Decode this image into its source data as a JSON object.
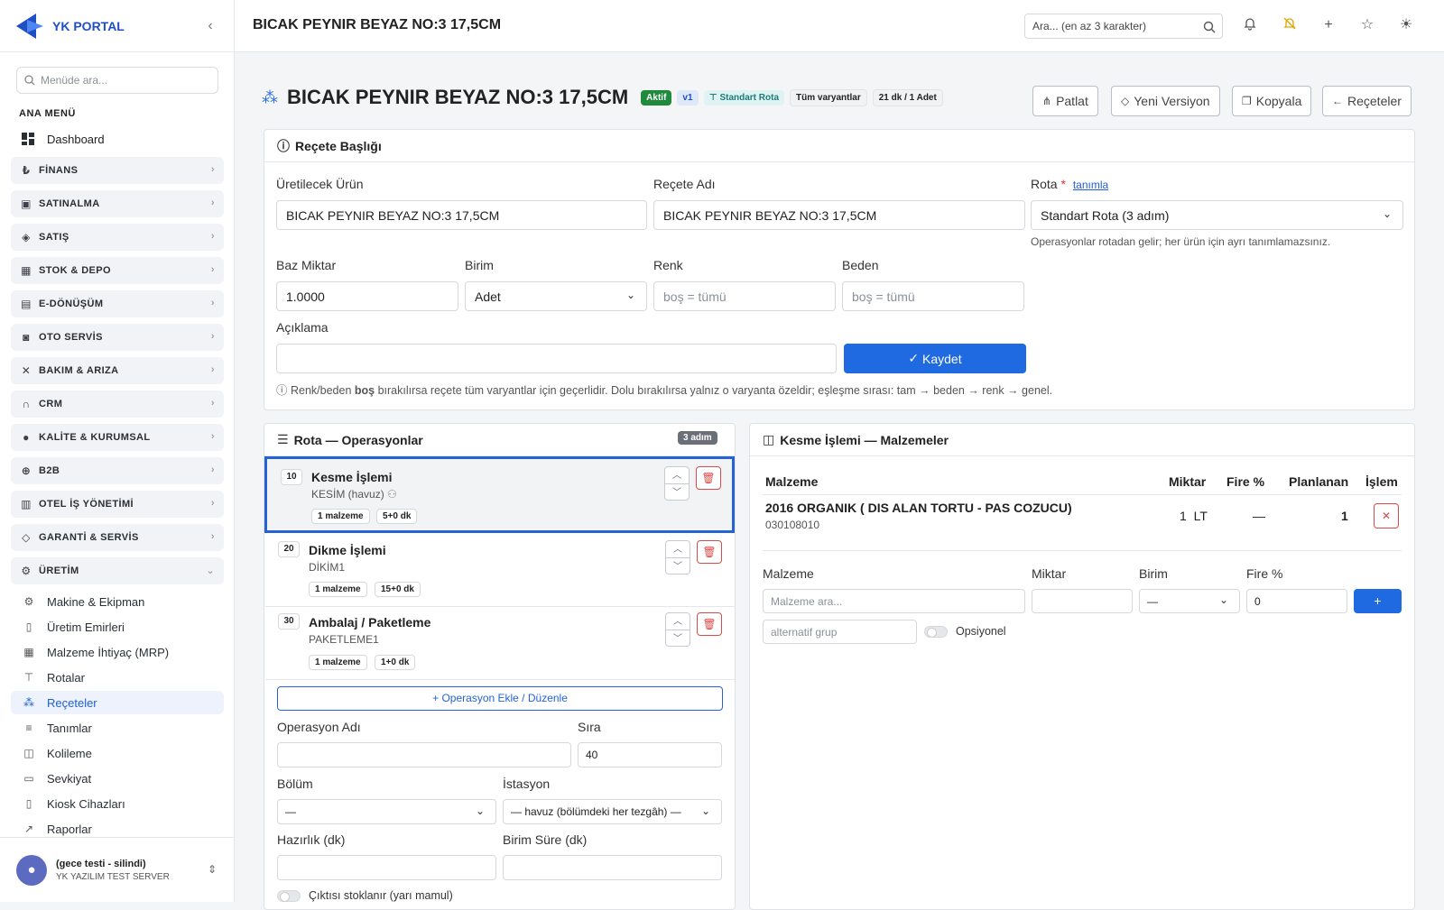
{
  "app": {
    "logo": "YK PORTAL",
    "page_title": "BICAK PEYNIR BEYAZ NO:3 17,5CM"
  },
  "sidebar": {
    "search_placeholder": "Menüde ara...",
    "section": "ANA MENÜ",
    "dashboard": "Dashboard",
    "groups": [
      "FİNANS",
      "SATINALMA",
      "SATIŞ",
      "STOK & DEPO",
      "E-DÖNÜŞÜM",
      "OTO SERVİS",
      "BAKIM & ARIZA",
      "CRM",
      "KALİTE & KURUMSAL",
      "B2B",
      "OTEL İŞ YÖNETİMİ",
      "GARANTİ & SERVİS",
      "ÜRETİM"
    ],
    "sub_items": [
      "Makine & Ekipman",
      "Üretim Emirleri",
      "Malzeme İhtiyaç (MRP)",
      "Rotalar",
      "Reçeteler",
      "Tanımlar",
      "Kolileme",
      "Sevkiyat",
      "Kiosk Cihazları",
      "Raporlar"
    ],
    "active_item": "Reçeteler",
    "user": {
      "name": "(gece testi - silindi)",
      "org": "YK YAZILIM TEST SERVER"
    }
  },
  "topbar": {
    "search_placeholder": "Ara... (en az 3 karakter)"
  },
  "header": {
    "title": "BICAK PEYNIR BEYAZ NO:3 17,5CM",
    "badges": {
      "status": "Aktif",
      "version": "v1",
      "route": "Standart Rota",
      "variants": "Tüm varyantlar",
      "time": "21 dk / 1 Adet"
    },
    "buttons": {
      "patlat": "Patlat",
      "new_version": "Yeni Versiyon",
      "copy": "Kopyala",
      "back": "Reçeteler"
    }
  },
  "recipe": {
    "card_title": "Reçete Başlığı",
    "product_label": "Üretilecek Ürün",
    "product_value": "BICAK PEYNIR BEYAZ NO:3 17,5CM",
    "name_label": "Reçete Adı",
    "name_value": "BICAK PEYNIR BEYAZ NO:3 17,5CM",
    "route_label": "Rota",
    "route_required": "*",
    "route_link": "tanımla",
    "route_value": "Standart Rota (3 adım)",
    "route_hint": "Operasyonlar rotadan gelir; her ürün için ayrı tanımlamazsınız.",
    "base_qty_label": "Baz Miktar",
    "base_qty_value": "1.0000",
    "unit_label": "Birim",
    "unit_value": "Adet",
    "color_label": "Renk",
    "color_placeholder": "boş = tümü",
    "size_label": "Beden",
    "size_placeholder": "boş = tümü",
    "desc_label": "Açıklama",
    "desc_value": "",
    "save_label": "Kaydet",
    "note_pre": "Renk/beden ",
    "note_bold": "boş",
    "note_post": " bırakılırsa reçete tüm varyantlar için geçerlidir. Dolu bırakılırsa yalnız o varyanta özeldir; eşleşme sırası: tam → beden → renk → genel."
  },
  "operations": {
    "card_title": "Rota — Operasyonlar",
    "count_badge": "3 adım",
    "items": [
      {
        "no": "10",
        "name": "Kesme İşlemi",
        "dept": "KESİM (havuz)",
        "materials": "1 malzeme",
        "time": "5+0 dk"
      },
      {
        "no": "20",
        "name": "Dikme İşlemi",
        "dept": "DİKİM1",
        "materials": "1 malzeme",
        "time": "15+0 dk"
      },
      {
        "no": "30",
        "name": "Ambalaj / Paketleme",
        "dept": "PAKETLEME1",
        "materials": "1 malzeme",
        "time": "1+0 dk"
      }
    ],
    "add_button": "Operasyon Ekle / Düzenle",
    "form": {
      "name_label": "Operasyon Adı",
      "name_value": "",
      "seq_label": "Sıra",
      "seq_value": "40",
      "dept_label": "Bölüm",
      "dept_value": "—",
      "station_label": "İstasyon",
      "station_value": "— havuz (bölümdeki her tezgâh) —",
      "prep_label": "Hazırlık (dk)",
      "unit_time_label": "Birim Süre (dk)",
      "stock_toggle_label": "Çıktısı stoklanır (yarı mamul)"
    }
  },
  "materials": {
    "card_title": "Kesme İşlemi — Malzemeler",
    "headers": {
      "material": "Malzeme",
      "qty": "Miktar",
      "fire": "Fire %",
      "planned": "Planlanan",
      "action": "İşlem"
    },
    "rows": [
      {
        "name": "2016 ORGANIK ( DIS ALAN TORTU - PAS COZUCU)",
        "code": "030108010",
        "qty": "1",
        "unit": "LT",
        "fire": "—",
        "planned": "1"
      }
    ],
    "form": {
      "material_label": "Malzeme",
      "material_placeholder": "Malzeme ara...",
      "qty_label": "Miktar",
      "unit_label": "Birim",
      "unit_value": "—",
      "fire_label": "Fire %",
      "fire_value": "0",
      "alt_group_placeholder": "alternatif grup",
      "optional_label": "Opsiyonel"
    }
  }
}
